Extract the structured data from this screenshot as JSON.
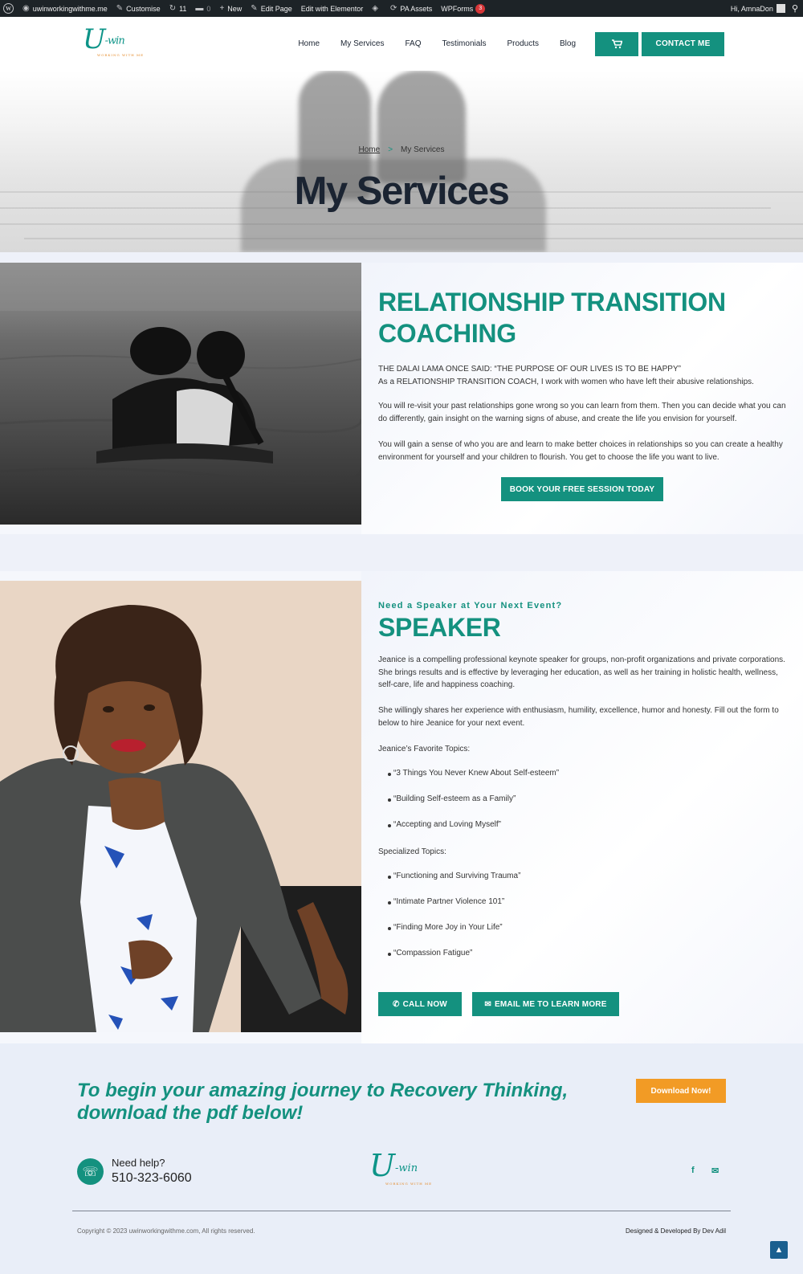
{
  "admin_bar": {
    "site": "uwinworkingwithme.me",
    "customise": "Customise",
    "updates": "11",
    "comments": "0",
    "new": "New",
    "edit_page": "Edit Page",
    "edit_elementor": "Edit with Elementor",
    "pa_assets": "PA Assets",
    "wpforms": "WPForms",
    "wpforms_count": "3",
    "greeting": "Hi, AmnaDon"
  },
  "logo": {
    "main": "U",
    "sub": "-win",
    "tagline": "WORKING WITH ME"
  },
  "nav": {
    "items": [
      "Home",
      "My Services",
      "FAQ",
      "Testimonials",
      "Products",
      "Blog"
    ],
    "cart_icon": "cart-icon",
    "contact_label": "CONTACT ME"
  },
  "hero": {
    "breadcrumb_home": "Home",
    "breadcrumb_sep": ">",
    "breadcrumb_current": "My Services",
    "title": "My Services"
  },
  "coaching": {
    "title_line1": "RELATIONSHIP TRANSITION",
    "title_line2": "COACHING",
    "para1_line1": "THE DALAI LAMA ONCE SAID: “THE PURPOSE OF OUR LIVES IS TO BE HAPPY”",
    "para1_line2": "As a RELATIONSHIP TRANSITION COACH, I work with women who have left their abusive relationships.",
    "para2": "You will re-visit your past relationships gone wrong so you can learn from them. Then you can decide what you can do differently, gain insight on the warning signs of abuse, and create the life you envision for yourself.",
    "para3": "You will gain a sense of who you are and learn to make better choices in relationships so you can create a healthy environment for yourself and your children to flourish. You get to choose the life you want to live.",
    "button": "BOOK YOUR FREE SESSION TODAY"
  },
  "speaker": {
    "eyebrow": "Need a Speaker at Your Next Event?",
    "title": "SPEAKER",
    "para1": "Jeanice is a compelling professional keynote speaker for groups, non-profit organizations and private corporations. She brings results and is effective by leveraging her education, as well as her training in holistic health, wellness, self-care, life and happiness coaching.",
    "para2": "She willingly shares her experience with enthusiasm, humility, excellence, humor and honesty. Fill out the form to below to hire Jeanice for your next event.",
    "favorite_heading": "Jeanice’s Favorite Topics:",
    "favorite_topics": [
      "“3 Things You Never Knew About Self-esteem”",
      "“Building Self-esteem as a Family”",
      "“Accepting and Loving Myself”"
    ],
    "specialized_heading": "Specialized Topics:",
    "specialized_topics": [
      "“Functioning and Surviving Trauma”",
      "“Intimate Partner Violence 101”",
      "“Finding More Joy in Your Life”",
      "“Compassion Fatigue”"
    ],
    "call_button": "CALL NOW",
    "email_button": "EMAIL ME TO LEARN MORE"
  },
  "cta": {
    "text_line1": "To begin your amazing journey to Recovery Thinking,",
    "text_line2": "download the pdf below!",
    "download_button": "Download Now!"
  },
  "footer": {
    "help_label": "Need help?",
    "phone": "510-323-6060",
    "copyright": "Copyright © 2023 uwinworkingwithme.com, All rights reserved.",
    "credit": "Designed & Developed By Dev Adil"
  },
  "colors": {
    "accent": "#14917f",
    "orange": "#f29b25",
    "dark": "#1b2432"
  }
}
